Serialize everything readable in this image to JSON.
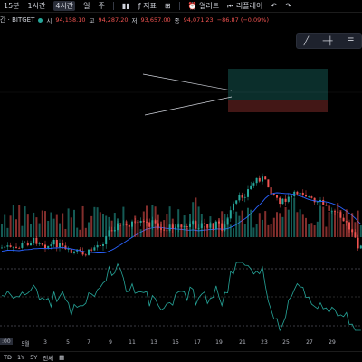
{
  "toolbar": {
    "items": [
      "15분",
      "1시간",
      "4시간",
      "일",
      "주"
    ],
    "active_index": 2,
    "indicators_label": "지표",
    "alert_label": "얼러트",
    "replay_label": "리플레이",
    "undo_icon": "undo-icon",
    "redo_icon": "redo-icon"
  },
  "legend": {
    "symbol": "간 · BITGET",
    "open_label": "시",
    "open": "94,158.10",
    "high_label": "고",
    "high": "94,287.20",
    "low_label": "저",
    "low": "93,657.00",
    "close_label": "종",
    "close": "94,071.23",
    "change": "−86.87 (−0.09%)",
    "status_color": "#26a69a"
  },
  "drawing_tools": [
    "line-tool-icon",
    "horizontal-line-icon",
    "fib-tool-icon"
  ],
  "date_axis": {
    "first_label": ":00",
    "labels": [
      "5월",
      "3",
      "5",
      "7",
      "9",
      "11",
      "13",
      "15",
      "17",
      "19",
      "21",
      "23",
      "25",
      "27",
      "29"
    ]
  },
  "bottom_bar": {
    "ranges": [
      "TD",
      "1Y",
      "5Y",
      "전체"
    ]
  },
  "colors": {
    "up": "#26a69a",
    "down": "#ef5350",
    "ma": "#2962ff",
    "osc": "#26a69a",
    "background": "#000000"
  },
  "chart_data": {
    "type": "candlestick",
    "xlabels": [
      "5월",
      "3",
      "5",
      "7",
      "9",
      "11",
      "13",
      "15",
      "17",
      "19",
      "21",
      "23",
      "25",
      "27",
      "29"
    ],
    "price_path": [
      [
        0,
        82
      ],
      [
        6,
        81
      ],
      [
        12,
        83
      ],
      [
        18,
        82
      ],
      [
        24,
        80
      ],
      [
        30,
        79
      ],
      [
        36,
        78
      ],
      [
        42,
        78
      ],
      [
        48,
        80
      ],
      [
        54,
        81
      ],
      [
        60,
        79
      ],
      [
        66,
        81
      ],
      [
        72,
        84
      ],
      [
        78,
        85
      ],
      [
        84,
        84
      ],
      [
        90,
        86
      ],
      [
        96,
        85
      ],
      [
        102,
        82
      ],
      [
        108,
        80
      ],
      [
        114,
        78
      ],
      [
        120,
        72
      ],
      [
        126,
        70
      ],
      [
        132,
        69
      ],
      [
        138,
        70
      ],
      [
        144,
        68
      ],
      [
        150,
        70
      ],
      [
        156,
        68
      ],
      [
        162,
        69
      ],
      [
        168,
        68
      ],
      [
        174,
        70
      ],
      [
        180,
        72
      ],
      [
        186,
        71
      ],
      [
        192,
        69
      ],
      [
        198,
        70
      ],
      [
        204,
        71
      ],
      [
        210,
        68
      ],
      [
        216,
        70
      ],
      [
        222,
        69
      ],
      [
        228,
        70
      ],
      [
        234,
        70
      ],
      [
        240,
        68
      ],
      [
        246,
        72
      ],
      [
        252,
        64
      ],
      [
        258,
        58
      ],
      [
        264,
        54
      ],
      [
        270,
        52
      ],
      [
        276,
        48
      ],
      [
        282,
        44
      ],
      [
        288,
        43
      ],
      [
        294,
        47
      ],
      [
        300,
        51
      ],
      [
        306,
        55
      ],
      [
        312,
        57
      ],
      [
        318,
        55
      ],
      [
        324,
        53
      ],
      [
        330,
        50
      ],
      [
        336,
        52
      ],
      [
        342,
        55
      ],
      [
        348,
        58
      ],
      [
        354,
        57
      ],
      [
        360,
        60
      ],
      [
        366,
        62
      ],
      [
        372,
        60
      ],
      [
        378,
        66
      ],
      [
        384,
        71
      ],
      [
        390,
        76
      ],
      [
        396,
        82
      ],
      [
        400,
        81
      ]
    ],
    "overlay_lines": [
      "trendline",
      "trendline",
      "rectangle-long",
      "rectangle-short"
    ],
    "indicators": [
      "moving-average",
      "volume",
      "oscillator"
    ]
  }
}
